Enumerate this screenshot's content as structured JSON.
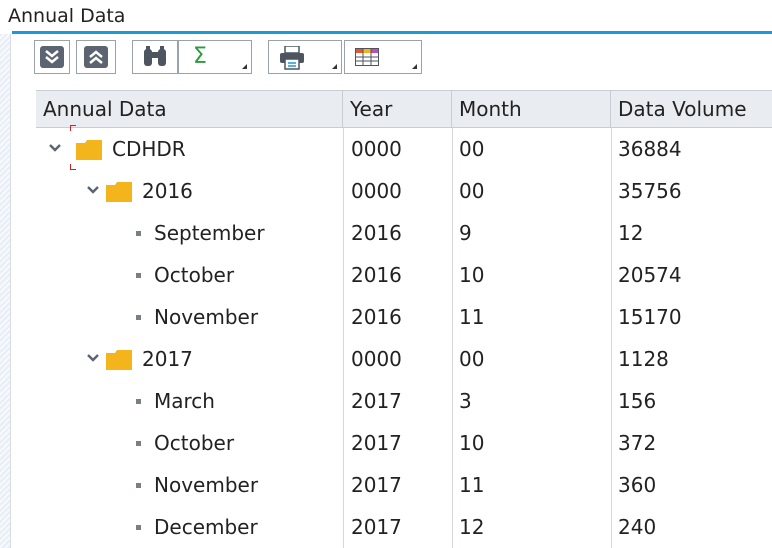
{
  "window": {
    "title": "Annual Data"
  },
  "toolbar": {
    "buttons": [
      {
        "icon": "expand-all-icon"
      },
      {
        "icon": "collapse-all-icon"
      },
      {
        "icon": "find-icon"
      },
      {
        "icon": "sum-icon",
        "glyph": "Σ"
      },
      {
        "icon": "print-icon"
      },
      {
        "icon": "layout-icon"
      }
    ]
  },
  "colors": {
    "accent": "#1a9bd7",
    "folder": "#f3b51b",
    "sum": "#2a9d3a"
  },
  "table": {
    "columns": [
      "Annual Data",
      "Year",
      "Month",
      "Data Volume"
    ],
    "rows": [
      {
        "label": "CDHDR",
        "year": "0000",
        "month": "00",
        "volume": "36884",
        "type": "folder",
        "level": 0
      },
      {
        "label": "2016",
        "year": "0000",
        "month": "00",
        "volume": "35756",
        "type": "folder",
        "level": 1
      },
      {
        "label": "September",
        "year": "2016",
        "month": "9",
        "volume": "12",
        "type": "leaf",
        "level": 2
      },
      {
        "label": "October",
        "year": "2016",
        "month": "10",
        "volume": "20574",
        "type": "leaf",
        "level": 2
      },
      {
        "label": "November",
        "year": "2016",
        "month": "11",
        "volume": "15170",
        "type": "leaf",
        "level": 2
      },
      {
        "label": "2017",
        "year": "0000",
        "month": "00",
        "volume": "1128",
        "type": "folder",
        "level": 1
      },
      {
        "label": "March",
        "year": "2017",
        "month": "3",
        "volume": "156",
        "type": "leaf",
        "level": 2
      },
      {
        "label": "October",
        "year": "2017",
        "month": "10",
        "volume": "372",
        "type": "leaf",
        "level": 2
      },
      {
        "label": "November",
        "year": "2017",
        "month": "11",
        "volume": "360",
        "type": "leaf",
        "level": 2
      },
      {
        "label": "December",
        "year": "2017",
        "month": "12",
        "volume": "240",
        "type": "leaf",
        "level": 2
      }
    ]
  }
}
